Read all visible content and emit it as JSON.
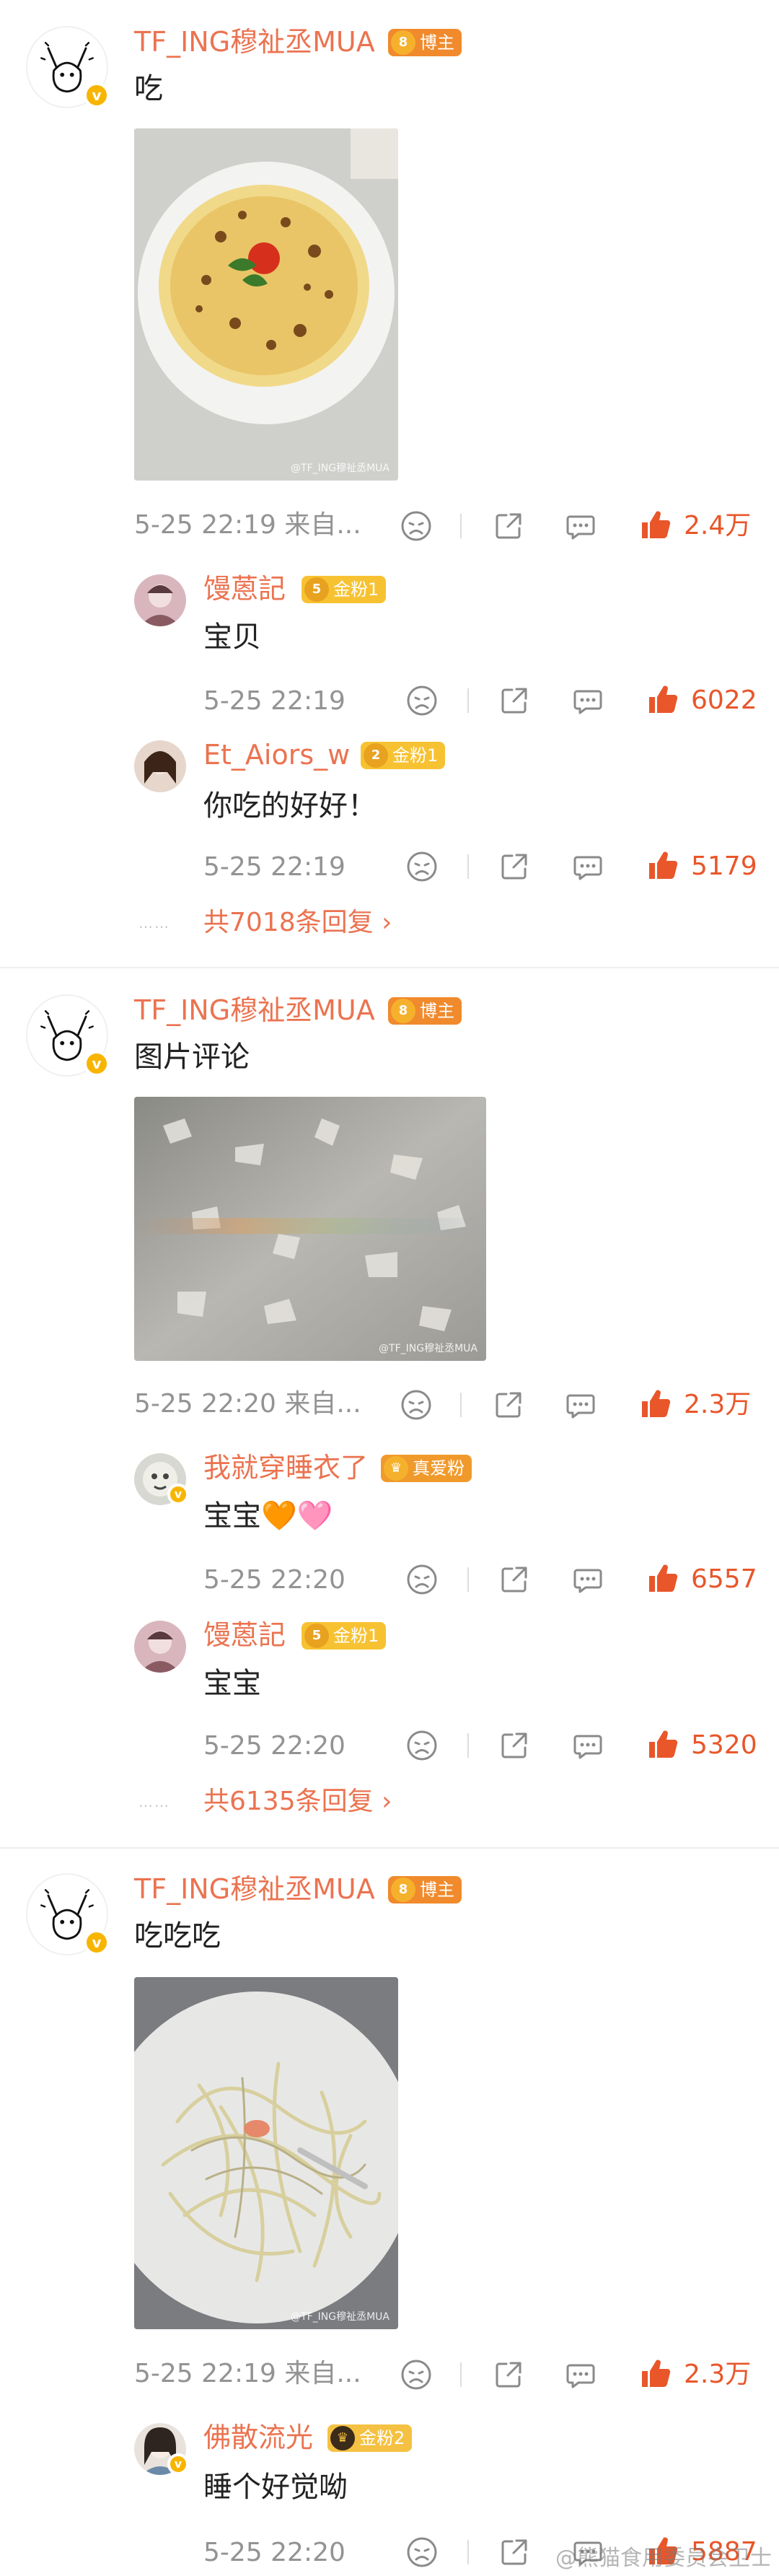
{
  "colors": {
    "accent": "#eb7350",
    "like": "#e8562a",
    "meta": "#939393",
    "host_badge": "#f08a2c",
    "fan_badge": "#f7c232"
  },
  "threads": [
    {
      "author": "TF_ING穆祉丞MUA",
      "badge": "博主",
      "badge_level": "8",
      "text": "吃",
      "photo_watermark": "@TF_ING穆祉丞MUA",
      "time": "5-25 22:19",
      "source": "来自...",
      "likes": "2.4万",
      "replies": [
        {
          "name": "馒蒽記",
          "badge": "金粉1",
          "badge_level": "5",
          "text": "宝贝",
          "time": "5-25 22:19",
          "likes": "6022"
        },
        {
          "name": "Et_Aiors_w",
          "badge": "金粉1",
          "badge_level": "2",
          "text": "你吃的好好！",
          "time": "5-25 22:19",
          "likes": "5179"
        }
      ],
      "more_replies": "共7018条回复",
      "more_dots": "……"
    },
    {
      "author": "TF_ING穆祉丞MUA",
      "badge": "博主",
      "badge_level": "8",
      "text": "图片评论",
      "photo_watermark": "@TF_ING穆祉丞MUA",
      "time": "5-25 22:20",
      "source": "来自...",
      "likes": "2.3万",
      "replies": [
        {
          "name": "我就穿睡衣了",
          "badge": "真爱粉",
          "badge_level": "",
          "text": "宝宝🧡🩷",
          "time": "5-25 22:20",
          "likes": "6557"
        },
        {
          "name": "馒蒽記",
          "badge": "金粉1",
          "badge_level": "5",
          "text": "宝宝",
          "time": "5-25 22:20",
          "likes": "5320"
        }
      ],
      "more_replies": "共6135条回复",
      "more_dots": "……"
    },
    {
      "author": "TF_ING穆祉丞MUA",
      "badge": "博主",
      "badge_level": "8",
      "text": "吃吃吃",
      "photo_watermark": "@TF_ING穆祉丞MUA",
      "time": "5-25 22:19",
      "source": "来自...",
      "likes": "2.3万",
      "replies": [
        {
          "name": "佛散流光",
          "badge": "金粉2",
          "badge_level": "",
          "text": "睡个好觉呦",
          "time": "5-25 22:20",
          "likes": "5887"
        }
      ]
    }
  ],
  "page_watermark": "@熊猫食用委员会卫士"
}
